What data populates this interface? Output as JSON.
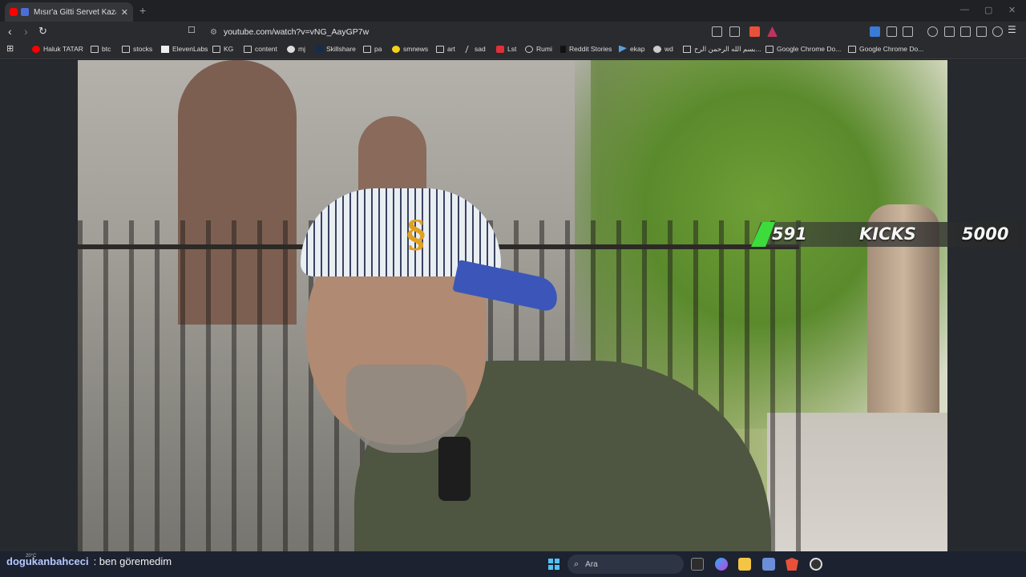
{
  "browser": {
    "tab_title": "Mısır'a Gitti Servet Kazandı - Ha",
    "tab_close": "✕",
    "new_tab": "+",
    "url": "youtube.com/watch?v=vNG_AayGP7w",
    "window_controls": [
      "—",
      "▢",
      "✕"
    ]
  },
  "bookmarks": [
    {
      "label": "Haluk TATAR",
      "icon": "youtube-icon"
    },
    {
      "label": "btc",
      "icon": "folder-icon"
    },
    {
      "label": "stocks",
      "icon": "folder-icon"
    },
    {
      "label": "ElevenLabs",
      "icon": "elevenlabs-icon"
    },
    {
      "label": "KG",
      "icon": "folder-icon"
    },
    {
      "label": "content",
      "icon": "folder-icon"
    },
    {
      "label": "mj",
      "icon": "github-icon"
    },
    {
      "label": "Skillshare",
      "icon": "skillshare-icon"
    },
    {
      "label": "pa",
      "icon": "folder-icon"
    },
    {
      "label": "smnews",
      "icon": "smiley-icon"
    },
    {
      "label": "art",
      "icon": "folder-icon"
    },
    {
      "label": "sad",
      "icon": "slash-icon"
    },
    {
      "label": "Lst",
      "icon": "s-icon"
    },
    {
      "label": "Rumi",
      "icon": "globe-icon"
    },
    {
      "label": "Reddit Stories",
      "icon": "d-icon"
    },
    {
      "label": "ekap",
      "icon": "ekap-icon"
    },
    {
      "label": "wd",
      "icon": "wd-icon"
    },
    {
      "label": "بسم الله الرحمن الرح...",
      "icon": "page-icon"
    },
    {
      "label": "Google Chrome Do...",
      "icon": "folder-icon"
    },
    {
      "label": "Google Chrome Do...",
      "icon": "folder-icon"
    }
  ],
  "overlay": {
    "kicks_count": "591",
    "kicks_label": "KICKS",
    "kicks_goal": "5000"
  },
  "chat": {
    "username": "dogukanbahceci",
    "message": ": ben göremedim"
  },
  "taskbar": {
    "weather": "20°C",
    "search_placeholder": "Ara"
  },
  "colors": {
    "overlay_accent": "#3ddc3d",
    "browser_bg": "#2a2b2e",
    "taskbar_bg": "#1c2230"
  }
}
